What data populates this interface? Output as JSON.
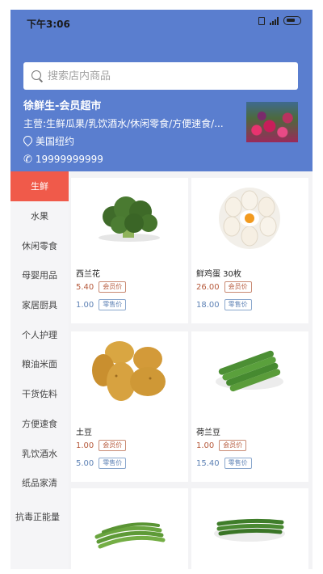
{
  "status_bar": {
    "time": "下午3:06"
  },
  "search": {
    "placeholder": "搜索店内商品"
  },
  "store": {
    "name": "徐鲜生-会员超市",
    "main_business": "主营:生鲜瓜果/乳饮酒水/休闲零食/方便速食/...",
    "location": "美国纽约",
    "phone": "19999999999"
  },
  "sidebar": {
    "categories": [
      {
        "label": "生鲜",
        "active": true
      },
      {
        "label": "水果"
      },
      {
        "label": "休闲零食"
      },
      {
        "label": "母婴用品"
      },
      {
        "label": "家居厨具"
      },
      {
        "label": "个人护理"
      },
      {
        "label": "粮油米面"
      },
      {
        "label": "干货佐料"
      },
      {
        "label": "方便速食"
      },
      {
        "label": "乳饮酒水"
      },
      {
        "label": "纸品家清"
      },
      {
        "label": "抗毒正能量"
      }
    ]
  },
  "price_tags": {
    "member": "会员价",
    "retail": "零售价"
  },
  "products": [
    {
      "name": "西兰花",
      "member_price": "5.40",
      "retail_price": "1.00",
      "icon": "broccoli-image"
    },
    {
      "name": "鲜鸡蛋 30枚",
      "member_price": "26.00",
      "retail_price": "18.00",
      "icon": "eggs-image"
    },
    {
      "name": "土豆",
      "member_price": "1.00",
      "retail_price": "5.00",
      "icon": "potato-image"
    },
    {
      "name": "荷兰豆",
      "member_price": "1.00",
      "retail_price": "15.40",
      "icon": "snow-peas-image"
    },
    {
      "name": "",
      "icon": "green-beans-image"
    },
    {
      "name": "",
      "icon": "long-beans-image"
    }
  ],
  "colors": {
    "header": "#5a7ecf",
    "active_category": "#f05a4a",
    "member_price": "#b65a3c",
    "retail_price": "#5e82b5"
  }
}
